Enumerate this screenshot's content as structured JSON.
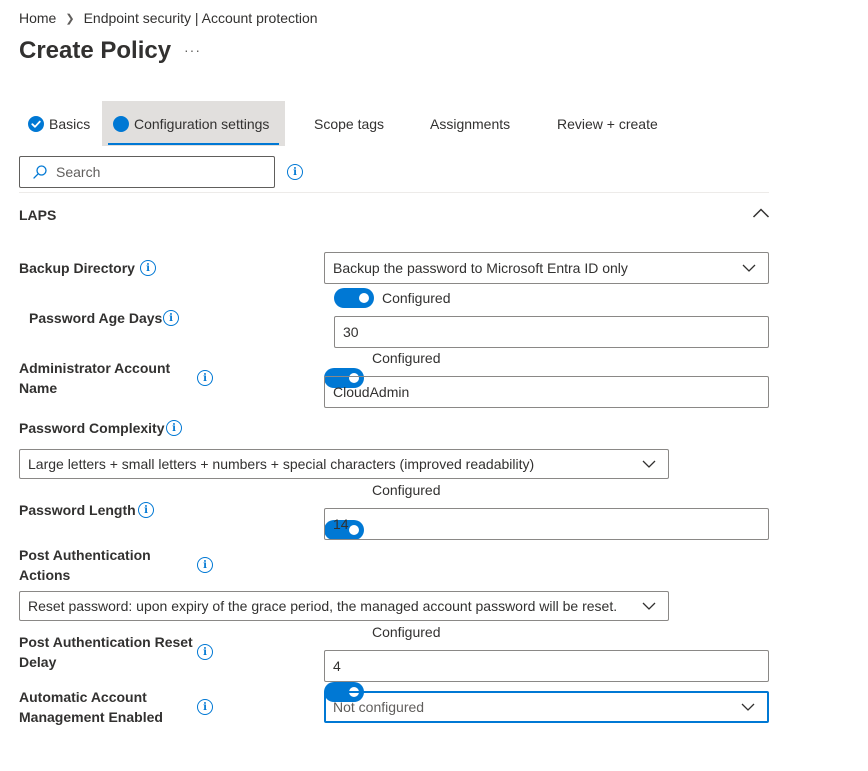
{
  "breadcrumb": {
    "home": "Home",
    "current": "Endpoint security | Account protection"
  },
  "page": {
    "title": "Create Policy",
    "more": "···"
  },
  "tabs": [
    {
      "label": "Basics"
    },
    {
      "label": "Configuration settings"
    },
    {
      "label": "Scope tags"
    },
    {
      "label": "Assignments"
    },
    {
      "label": "Review + create"
    }
  ],
  "search": {
    "placeholder": "Search"
  },
  "section": {
    "title": "LAPS"
  },
  "settings": {
    "backup_directory": {
      "label": "Backup Directory",
      "value": "Backup the password to Microsoft Entra ID only"
    },
    "password_age_days": {
      "label": "Password Age Days",
      "toggle": "Configured",
      "value": "30"
    },
    "admin_account_name": {
      "label_line1": "Administrator Account",
      "label_line2": "Name",
      "toggle": "Configured",
      "value": "CloudAdmin"
    },
    "password_complexity": {
      "label": "Password Complexity",
      "value": "Large letters + small letters + numbers + special characters (improved readability)"
    },
    "password_length": {
      "label": "Password Length",
      "toggle": "Configured",
      "value": "14"
    },
    "post_auth_actions": {
      "label_line1": "Post Authentication",
      "label_line2": "Actions",
      "value": "Reset password: upon expiry of the grace period, the managed account password will be reset."
    },
    "post_auth_reset_delay": {
      "label_line1": "Post Authentication Reset",
      "label_line2": "Delay",
      "toggle": "Configured",
      "value": "4"
    },
    "auto_account_mgmt": {
      "label_line1": "Automatic Account",
      "label_line2": "Management Enabled",
      "value": "Not configured"
    }
  },
  "colors": {
    "accent": "#0078d4",
    "active_tab_bg": "#e1dfdd",
    "border": "#8a8886"
  },
  "icons": {
    "info": "info-icon",
    "search": "search-icon",
    "chevron_down": "chevron-down-icon",
    "chevron_up": "chevron-up-icon",
    "check": "check-circle-icon"
  }
}
